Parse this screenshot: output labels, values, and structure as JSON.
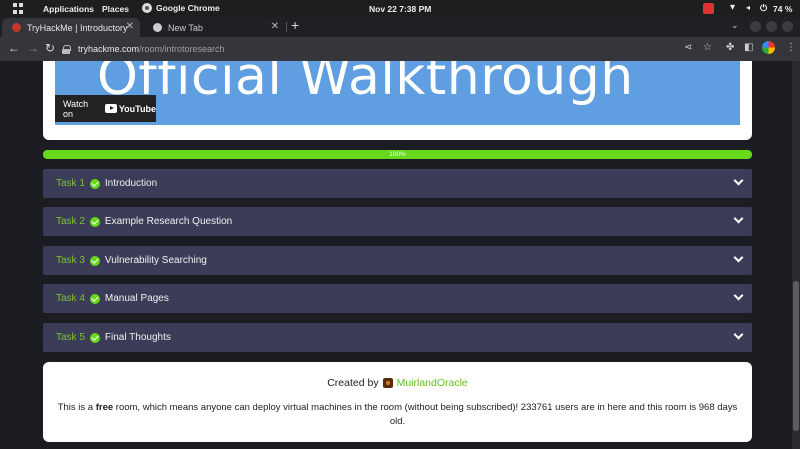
{
  "topbar": {
    "applications": "Applications",
    "places": "Places",
    "app_name": "Google Chrome",
    "clock": "Nov 22  7:38 PM",
    "battery": "74 %"
  },
  "tabs": [
    {
      "title": "TryHackMe | Introductory",
      "active": true
    },
    {
      "title": "New Tab",
      "active": false
    }
  ],
  "address_bar": {
    "host": "tryhackme.com",
    "path": "/room/introtoresearch"
  },
  "video": {
    "title": "Official Walkthrough",
    "watch_on": "Watch on",
    "youtube": "YouTube"
  },
  "progress": {
    "label": "100%",
    "value": 1.0
  },
  "tasks": [
    {
      "number": "Task 1",
      "title": "Introduction"
    },
    {
      "number": "Task 2",
      "title": "Example Research Question"
    },
    {
      "number": "Task 3",
      "title": "Vulnerability Searching"
    },
    {
      "number": "Task 4",
      "title": "Manual Pages"
    },
    {
      "number": "Task 5",
      "title": "Final Thoughts"
    }
  ],
  "footer": {
    "created_by": "Created by",
    "author": "MuirlandOracle",
    "info_prefix": "This is a ",
    "info_free": "free",
    "info_suffix": " room, which means anyone can deploy virtual machines in the room (without being subscribed)! 233761 users are in here and this room is 968 days old."
  },
  "colors": {
    "accent_green": "#66d91a",
    "task_bg": "#3b3c58",
    "video_bg": "#5f9fe1"
  }
}
